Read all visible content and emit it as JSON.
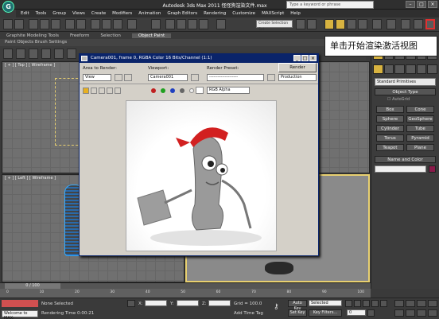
{
  "app": {
    "title": "Autodesk 3ds Max   2011      怪怪狗渲染文件.max",
    "search_placeholder": "Type a keyword or phrase",
    "logo": "3ds-max-logo"
  },
  "menu": [
    "Edit",
    "Tools",
    "Group",
    "Views",
    "Create",
    "Modifiers",
    "Animation",
    "Graph Editors",
    "Rendering",
    "Customize",
    "MAXScript",
    "Help"
  ],
  "toolbar": {
    "selection_set_placeholder": "Create Selection Set"
  },
  "ribbon": {
    "tabs": [
      "Graphite Modeling Tools",
      "Freeform",
      "Selection",
      "Object Paint"
    ],
    "active": "Object Paint",
    "sub": "Paint Objects  Brush Settings"
  },
  "viewports": {
    "top_label": "[ + ] [ Top ] [ Wireframe ]",
    "left_label": "[ + ] [ Left ] [ Wireframe ]"
  },
  "dialog": {
    "title": "Camera001, frame 0, RGBA Color 16 Bits/Channel (1:1)",
    "area_label": "Area to Render:",
    "area_value": "View",
    "viewport_label": "Viewport:",
    "viewport_value": "Camera001",
    "preset_label": "Render Preset:",
    "preset_value": "--------------------",
    "render_button": "Render",
    "mode_value": "Production",
    "channel_value": "RGB Alpha"
  },
  "command_panel": {
    "category": "Standard Primitives",
    "object_type_title": "Object Type",
    "autogrid": "AutoGrid",
    "buttons": [
      "Box",
      "Cone",
      "Sphere",
      "GeoSphere",
      "Cylinder",
      "Tube",
      "Torus",
      "Pyramid",
      "Teapot",
      "Plane"
    ],
    "name_color_title": "Name and Color"
  },
  "callout": {
    "text": "单击开始渲染激活视图"
  },
  "timeline": {
    "frame": "0 / 100",
    "ticks": [
      "0",
      "10",
      "20",
      "30",
      "40",
      "50",
      "60",
      "70",
      "80",
      "90",
      "100"
    ]
  },
  "status": {
    "welcome": "Welcome to MAX:",
    "selection": "None Selected",
    "rendering_time": "Rendering Time  0:00:21",
    "x_label": "X:",
    "y_label": "Y:",
    "z_label": "Z:",
    "grid": "Grid = 100.0",
    "add_time_tag": "Add Time Tag",
    "auto_key": "Auto Key",
    "set_key": "Set Key",
    "selected": "Selected",
    "key_filters": "Key Filters...",
    "frame_num": "0"
  },
  "colors": {
    "callout_border": "#222222",
    "render_active_highlight": "#e03030",
    "dialog_titlebar": "#0a246a"
  }
}
